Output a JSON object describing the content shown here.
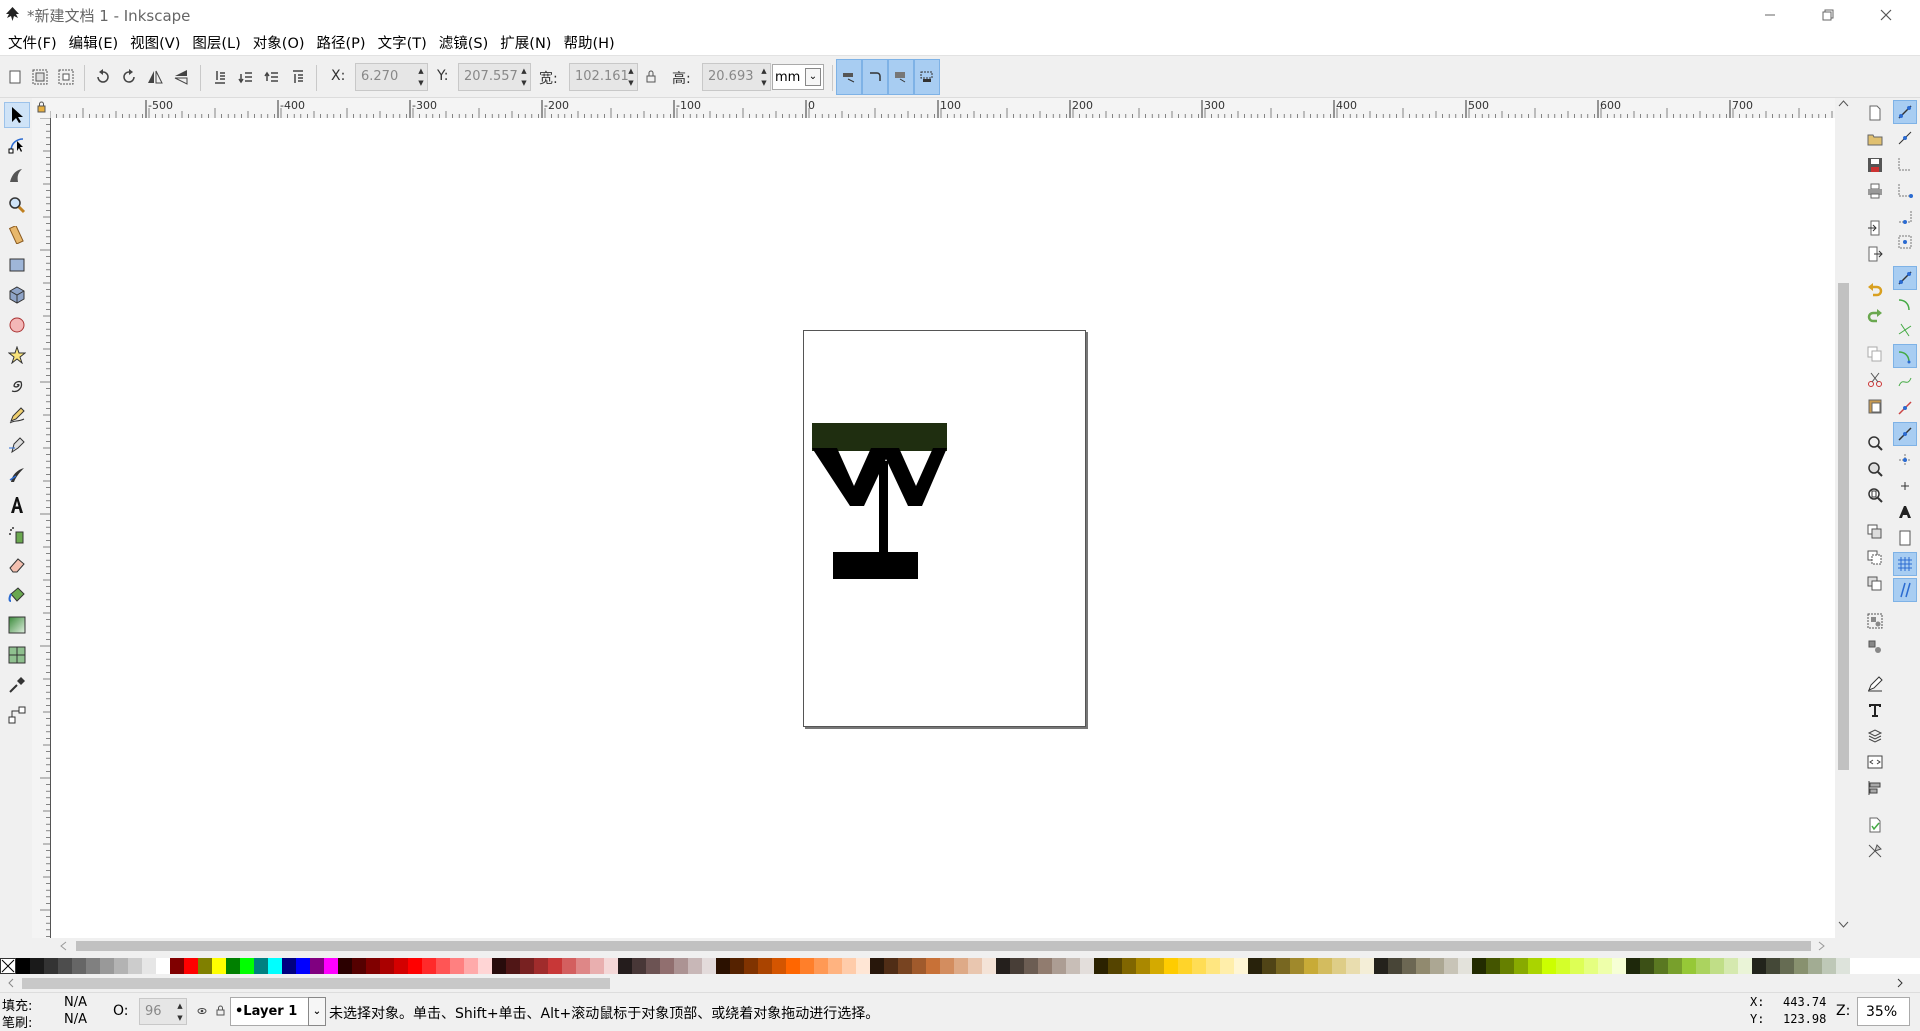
{
  "window": {
    "title": "*新建文档 1 - Inkscape"
  },
  "menu": [
    "文件(F)",
    "编辑(E)",
    "视图(V)",
    "图层(L)",
    "对象(O)",
    "路径(P)",
    "文字(T)",
    "滤镜(S)",
    "扩展(N)",
    "帮助(H)"
  ],
  "controls": {
    "x_label": "X:",
    "x_value": "6.270",
    "y_label": "Y:",
    "y_value": "207.557",
    "w_label": "宽:",
    "w_value": "102.161",
    "h_label": "高:",
    "h_value": "20.693",
    "unit": "mm"
  },
  "ruler": {
    "top_labels": [
      "-500",
      "-400",
      "-300",
      "-200",
      "-100",
      "0",
      "100",
      "200",
      "300",
      "400",
      "500",
      "600",
      "700"
    ]
  },
  "status": {
    "fill_label": "填充:",
    "fill_value": "N/A",
    "stroke_label": "笔刷:",
    "stroke_value": "N/A",
    "opacity_label": "O:",
    "opacity_value": "96",
    "layer": "•Layer 1",
    "message": "未选择对象。单击、Shift+单击、Alt+滚动鼠标于对象顶部、或绕着对象拖动进行选择。",
    "cursor_x_label": "X:",
    "cursor_x": "443.74",
    "cursor_y_label": "Y:",
    "cursor_y": "123.98",
    "zoom_label": "Z:",
    "zoom": "35%"
  },
  "colors": {
    "canvas_bg": "#ffffff",
    "shape_dark_green": "#1f2e10",
    "shape_black": "#000000",
    "toggle_active": "#a8cdf2"
  },
  "palette_colors": [
    "#000000",
    "#1a1a1a",
    "#333333",
    "#4d4d4d",
    "#666666",
    "#808080",
    "#999999",
    "#b3b3b3",
    "#cccccc",
    "#e6e6e6",
    "#ffffff",
    "#800000",
    "#ff0000",
    "#808000",
    "#ffff00",
    "#008000",
    "#00ff00",
    "#008080",
    "#00ffff",
    "#000080",
    "#0000ff",
    "#800080",
    "#ff00ff",
    "#2b0000",
    "#550000",
    "#800000",
    "#aa0000",
    "#d40000",
    "#ff0000",
    "#ff2a2a",
    "#ff5555",
    "#ff8080",
    "#ffaaaa",
    "#ffd5d5",
    "#280b0b",
    "#501616",
    "#782121",
    "#a02c2c",
    "#c83737",
    "#d35f5f",
    "#de8787",
    "#e9afaf",
    "#f4d7d7",
    "#241c1c",
    "#483737",
    "#6c5353",
    "#916f6f",
    "#ac9393",
    "#c8b7b7",
    "#e3dbdb",
    "#2b1100",
    "#552200",
    "#803300",
    "#aa4400",
    "#d45500",
    "#ff6600",
    "#ff7f2a",
    "#ff9955",
    "#ffb380",
    "#ffccaa",
    "#ffe6d5",
    "#28170b",
    "#502d16",
    "#784421",
    "#a05a2c",
    "#c87137",
    "#d38d5f",
    "#deaa87",
    "#e9c6af",
    "#f4e3d7",
    "#241f1c",
    "#483e37",
    "#6c5d53",
    "#917c6f",
    "#ac9d93",
    "#c8beb7",
    "#e3dedb",
    "#2b2200",
    "#554400",
    "#806600",
    "#aa8800",
    "#d4aa00",
    "#ffcc00",
    "#ffd42a",
    "#ffdd55",
    "#ffe680",
    "#ffeeaa",
    "#fff6d5",
    "#28220b",
    "#504416",
    "#786721",
    "#a0892c",
    "#c8ab37",
    "#d3bc5f",
    "#decd87",
    "#e9ddaf",
    "#f4eed7",
    "#24221c",
    "#484537",
    "#6c6753",
    "#918a6f",
    "#aca793",
    "#c8c4b7",
    "#e3e2db",
    "#222b00",
    "#445500",
    "#668000",
    "#88aa00",
    "#aad400",
    "#ccff00",
    "#d4ff2a",
    "#ddff55",
    "#e5ff80",
    "#eeffaa",
    "#f6ffd5",
    "#1e280b",
    "#3c5016",
    "#5a7821",
    "#78a02c",
    "#96c837",
    "#abd35f",
    "#c0de87",
    "#d5e9af",
    "#eaf4d7",
    "#22241c",
    "#444837",
    "#666c53",
    "#88916f",
    "#a2ac93",
    "#bec8b7",
    "#dde3db"
  ],
  "icons": {
    "tools": [
      "selector-icon",
      "node-icon",
      "tweak-icon",
      "zoom-icon",
      "measure-icon",
      "rect-icon",
      "3dbox-icon",
      "ellipse-icon",
      "star-icon",
      "spiral-icon",
      "pencil-icon",
      "pen-icon",
      "calligraphy-icon",
      "text-icon",
      "spray-icon",
      "eraser-icon",
      "bucket-icon",
      "gradient-icon",
      "mesh-icon",
      "dropper-icon",
      "connector-icon"
    ]
  }
}
